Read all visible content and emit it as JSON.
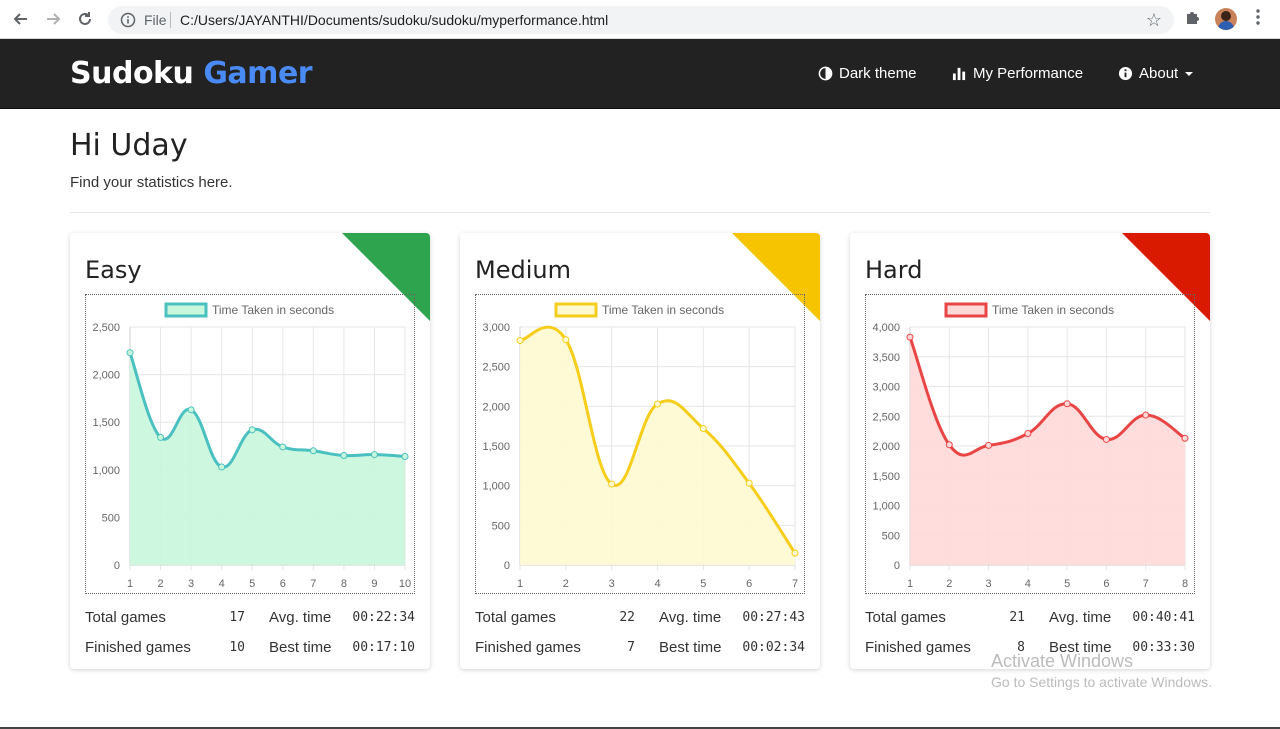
{
  "browser": {
    "file_label": "File",
    "url": "C:/Users/JAYANTHI/Documents/sudoku/sudoku/myperformance.html"
  },
  "navbar": {
    "brand_main": "Sudoku",
    "brand_accent": "Gamer",
    "dark_theme": "Dark theme",
    "my_performance": "My Performance",
    "about": "About"
  },
  "header": {
    "greeting": "Hi Uday",
    "subtitle": "Find your statistics here."
  },
  "cards": [
    {
      "title": "Easy",
      "corner_color": "#2ea44f",
      "stats": {
        "total_label": "Total games",
        "total": "17",
        "avg_label": "Avg. time",
        "avg": "00:22:34",
        "finished_label": "Finished games",
        "finished": "10",
        "best_label": "Best time",
        "best": "00:17:10"
      }
    },
    {
      "title": "Medium",
      "corner_color": "#f6c400",
      "stats": {
        "total_label": "Total games",
        "total": "22",
        "avg_label": "Avg. time",
        "avg": "00:27:43",
        "finished_label": "Finished games",
        "finished": "7",
        "best_label": "Best time",
        "best": "00:02:34"
      }
    },
    {
      "title": "Hard",
      "corner_color": "#d91a00",
      "stats": {
        "total_label": "Total games",
        "total": "21",
        "avg_label": "Avg. time",
        "avg": "00:40:41",
        "finished_label": "Finished games",
        "finished": "8",
        "best_label": "Best time",
        "best": "00:33:30"
      }
    }
  ],
  "chart_data": [
    {
      "type": "area",
      "legend": "Time Taken in seconds",
      "line_color": "#4bc0c0",
      "fill_color": "#c8f7dc",
      "x": [
        1,
        2,
        3,
        4,
        5,
        6,
        7,
        8,
        9,
        10
      ],
      "values": [
        2230,
        1340,
        1630,
        1030,
        1420,
        1240,
        1200,
        1150,
        1160,
        1140
      ],
      "ylim": [
        0,
        2500
      ],
      "yticks": [
        0,
        500,
        1000,
        1500,
        2000,
        2500
      ],
      "ytick_labels": [
        "0",
        "500",
        "1,000",
        "1,500",
        "2,000",
        "2,500"
      ]
    },
    {
      "type": "area",
      "legend": "Time Taken in seconds",
      "line_color": "#f6cd1b",
      "fill_color": "#fdfad0",
      "x": [
        1,
        2,
        3,
        4,
        5,
        6,
        7
      ],
      "values": [
        2830,
        2840,
        1020,
        2030,
        1720,
        1030,
        150
      ],
      "ylim": [
        0,
        3000
      ],
      "yticks": [
        0,
        500,
        1000,
        1500,
        2000,
        2500,
        3000
      ],
      "ytick_labels": [
        "0",
        "500",
        "1,000",
        "1,500",
        "2,000",
        "2,500",
        "3,000"
      ]
    },
    {
      "type": "area",
      "legend": "Time Taken in seconds",
      "line_color": "#e84545",
      "fill_color": "#ffd9d9",
      "x": [
        1,
        2,
        3,
        4,
        5,
        6,
        7,
        8
      ],
      "values": [
        3830,
        2020,
        2010,
        2210,
        2710,
        2110,
        2520,
        2130
      ],
      "ylim": [
        0,
        4000
      ],
      "yticks": [
        0,
        500,
        1000,
        1500,
        2000,
        2500,
        3000,
        3500,
        4000
      ],
      "ytick_labels": [
        "0",
        "500",
        "1,000",
        "1,500",
        "2,000",
        "2,500",
        "3,000",
        "3,500",
        "4,000"
      ]
    }
  ],
  "watermark": {
    "line1": "Activate Windows",
    "line2": "Go to Settings to activate Windows."
  }
}
